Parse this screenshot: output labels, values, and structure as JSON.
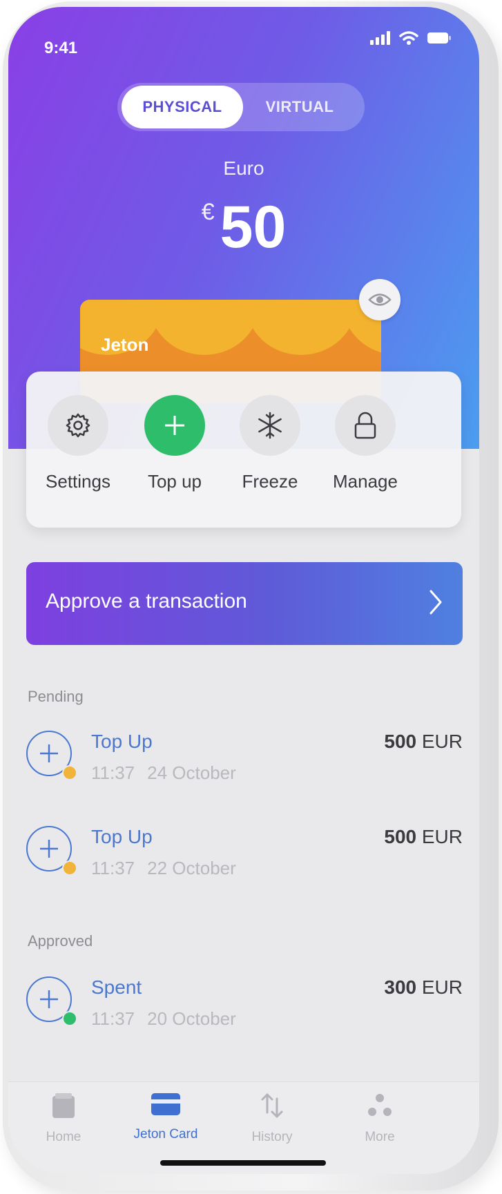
{
  "status": {
    "time": "9:41"
  },
  "card_type": {
    "physical": "PHYSICAL",
    "virtual": "VIRTUAL",
    "selected": "PHYSICAL"
  },
  "balance": {
    "currency_name": "Euro",
    "symbol": "€",
    "amount": "50"
  },
  "card": {
    "brand": "Jeton",
    "colors": {
      "base": "#ec8f2a",
      "pattern": "#f3b32e"
    }
  },
  "actions": [
    {
      "label": "Settings",
      "icon": "gear-icon"
    },
    {
      "label": "Top up",
      "icon": "plus-icon"
    },
    {
      "label": "Freeze",
      "icon": "snowflake-icon"
    },
    {
      "label": "Manage",
      "icon": "lock-icon"
    }
  ],
  "approve_banner": {
    "label": "Approve a transaction"
  },
  "sections": {
    "pending": "Pending",
    "approved": "Approved"
  },
  "transactions": {
    "pending": [
      {
        "title": "Top Up",
        "time": "11:37",
        "date": "24 October",
        "amount": "500",
        "currency": "EUR",
        "status_color": "#f0b43a"
      },
      {
        "title": "Top Up",
        "time": "11:37",
        "date": "22 October",
        "amount": "500",
        "currency": "EUR",
        "status_color": "#f0b43a"
      }
    ],
    "approved": [
      {
        "title": "Spent",
        "time": "11:37",
        "date": "20 October",
        "amount": "300",
        "currency": "EUR",
        "status_color": "#2ebd6a"
      }
    ]
  },
  "tabbar": [
    {
      "label": "Home",
      "icon": "wallet-icon",
      "active": false
    },
    {
      "label": "Jeton Card",
      "icon": "card-icon",
      "active": true
    },
    {
      "label": "History",
      "icon": "arrows-icon",
      "active": false
    },
    {
      "label": "More",
      "icon": "dots-icon",
      "active": false
    }
  ],
  "colors": {
    "accent": "#4a78d0",
    "gradient_start": "#8a3fe6",
    "gradient_end": "#4b9df0",
    "green": "#2ebd6a"
  }
}
